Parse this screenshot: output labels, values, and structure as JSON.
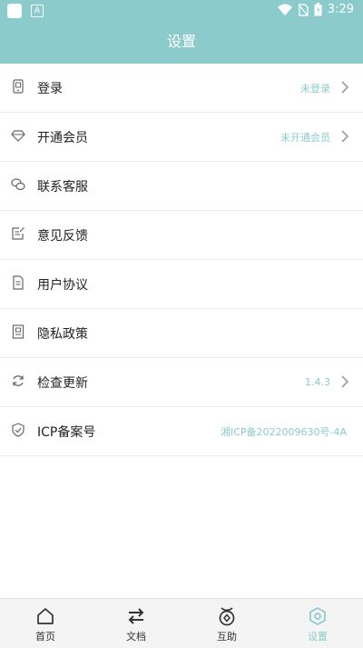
{
  "status_bar": {
    "time": "3:29",
    "badge": "A",
    "icons": [
      "app-square-icon",
      "a-badge-icon",
      "wifi-icon",
      "no-sim-icon",
      "battery-icon"
    ]
  },
  "header": {
    "title": "设置"
  },
  "menu": {
    "items": [
      {
        "label": "登录",
        "value": "未登录",
        "icon": "phone-icon",
        "has_arrow": true
      },
      {
        "label": "开通会员",
        "value": "未开通会员",
        "icon": "diamond-icon",
        "has_arrow": true
      },
      {
        "label": "联系客服",
        "value": "",
        "icon": "chat-icon",
        "has_arrow": false
      },
      {
        "label": "意见反馈",
        "value": "",
        "icon": "feedback-icon",
        "has_arrow": false
      },
      {
        "label": "用户协议",
        "value": "",
        "icon": "document-icon",
        "has_arrow": false
      },
      {
        "label": "隐私政策",
        "value": "",
        "icon": "privacy-icon",
        "has_arrow": false
      },
      {
        "label": "检查更新",
        "value": "1.4.3",
        "icon": "refresh-icon",
        "has_arrow": true
      },
      {
        "label": "ICP备案号",
        "value": "湘ICP备2022009630号-4A",
        "icon": "shield-icon",
        "has_arrow": false
      }
    ]
  },
  "tabbar": {
    "tabs": [
      {
        "label": "首页",
        "icon": "home-icon",
        "active": false
      },
      {
        "label": "文档",
        "icon": "swap-icon",
        "active": false
      },
      {
        "label": "互助",
        "icon": "help-icon",
        "active": false
      },
      {
        "label": "设置",
        "icon": "settings-icon",
        "active": true
      }
    ]
  },
  "colors": {
    "accent": "#8ccbcc",
    "text": "#222222",
    "divider": "#ececec"
  }
}
